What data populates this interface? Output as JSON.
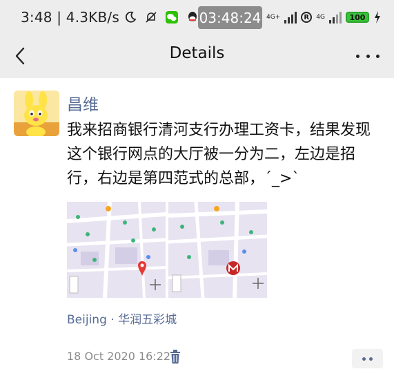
{
  "status_bar": {
    "left_text": "3:48 | 4.3KB/s",
    "clock": "03:48:24",
    "network_1": "4G+",
    "network_2": "4G",
    "battery": "100"
  },
  "nav": {
    "title": "Details"
  },
  "post": {
    "author": "昌维",
    "text": "我来招商银行清河支行办理工资卡，结果发现这个银行网点的大厅被一分为二，左边是招行，右边是第四范式的总部，´_>`",
    "location": "Beijing · 华润五彩城",
    "timestamp": "18 Oct 2020 16:22"
  },
  "colors": {
    "link": "#576b95",
    "topbar_bg": "#ededed",
    "map_bg": "#e7e3f1",
    "map_road": "#ffffff",
    "map_green": "#3fb47a",
    "pin_red": "#e53935"
  },
  "icons": {
    "back": "chevron-left-icon",
    "more": "more-horizontal-icon",
    "delete": "trash-icon",
    "comment": "comment-dots-icon"
  }
}
